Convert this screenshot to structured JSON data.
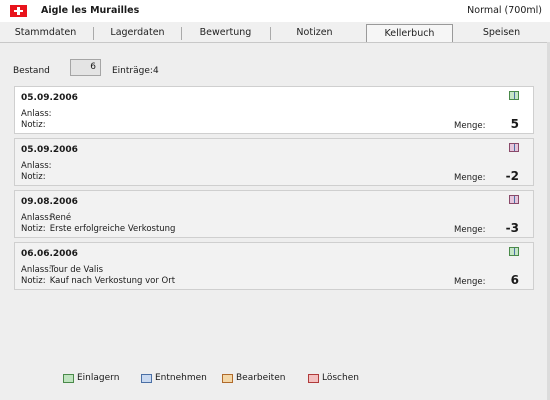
{
  "header": {
    "wine_name": "Aigle les Murailles",
    "bottle_size": "Normal (700ml)",
    "flag_icon": "swiss-flag-icon",
    "flag_color": "#e8141c"
  },
  "tabs": [
    {
      "label": "Stammdaten"
    },
    {
      "label": "Lagerdaten"
    },
    {
      "label": "Bewertung"
    },
    {
      "label": "Notizen"
    },
    {
      "label": "Kellerbuch"
    },
    {
      "label": "Speisen"
    }
  ],
  "active_tab": "Kellerbuch",
  "summary": {
    "bestand_label": "Bestand",
    "bestand_value": "6",
    "eintraege_label": "Einträge:",
    "eintraege_value": "4"
  },
  "entries": [
    {
      "date": "05.09.2006",
      "anlass_label": "Anlass:",
      "anlass": "",
      "notiz_label": "Notiz:",
      "notiz": "",
      "menge_label": "Menge:",
      "menge": "5",
      "icon": "book-in-icon"
    },
    {
      "date": "05.09.2006",
      "anlass_label": "Anlass:",
      "anlass": "",
      "notiz_label": "Notiz:",
      "notiz": "",
      "menge_label": "Menge:",
      "menge": "-2",
      "icon": "book-out-icon"
    },
    {
      "date": "09.08.2006",
      "anlass_label": "Anlass:",
      "anlass": "René",
      "notiz_label": "Notiz:",
      "notiz": "Erste erfolgreiche Verkostung",
      "menge_label": "Menge:",
      "menge": "-3",
      "icon": "book-out-icon"
    },
    {
      "date": "06.06.2006",
      "anlass_label": "Anlass:",
      "anlass": "Tour de Valis",
      "notiz_label": "Notiz:",
      "notiz": "Kauf nach Verkostung vor Ort",
      "menge_label": "Menge:",
      "menge": "6",
      "icon": "book-in-icon"
    }
  ],
  "toolbar": {
    "einlagern": "Einlagern",
    "entnehmen": "Entnehmen",
    "bearbeiten": "Bearbeiten",
    "loeschen": "Löschen"
  }
}
